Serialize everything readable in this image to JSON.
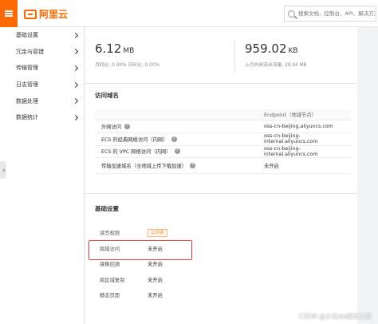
{
  "header": {
    "logo_text": "阿里云",
    "search_placeholder": "搜索文档、控制台、API、解决方案和资源"
  },
  "sidebar": {
    "items": [
      {
        "label": "基础设置"
      },
      {
        "label": "冗余与容错"
      },
      {
        "label": "传输管理"
      },
      {
        "label": "日志管理"
      },
      {
        "label": "数据处理"
      },
      {
        "label": "数据统计"
      }
    ]
  },
  "metrics": [
    {
      "value": "6.12",
      "unit": "MB",
      "sub": "月同比: 0.00%  日环比: 0.00%"
    },
    {
      "value": "959.02",
      "unit": "KB",
      "sub": "上月外网流出流量: 28.94 MB"
    }
  ],
  "access_domain": {
    "title": "访问域名",
    "column_header": "Endpoint（地域节点）",
    "rows": [
      {
        "label": "外网访问",
        "value": "oss-cn-beijing.aliyuncs.com"
      },
      {
        "label": "ECS 的经典网络访问（内网）",
        "value": "oss-cn-beijing-internal.aliyuncs.com"
      },
      {
        "label": "ECS 的 VPC 网络访问（内网）",
        "value": "oss-cn-beijing-internal.aliyuncs.com"
      },
      {
        "label": "传输加速域名（全地域上传下载加速）",
        "value": "未开启"
      }
    ]
  },
  "basic_settings": {
    "title": "基础设置",
    "rows": [
      {
        "label": "读写权限",
        "value": "公共读"
      },
      {
        "label": "跨域访问",
        "value": "未开启"
      },
      {
        "label": "镜像回源",
        "value": "未开启"
      },
      {
        "label": "跨区域复制",
        "value": "未开启"
      },
      {
        "label": "静态页面",
        "value": "未开启"
      }
    ]
  },
  "watermark": "CSDN @小白de成长之路"
}
